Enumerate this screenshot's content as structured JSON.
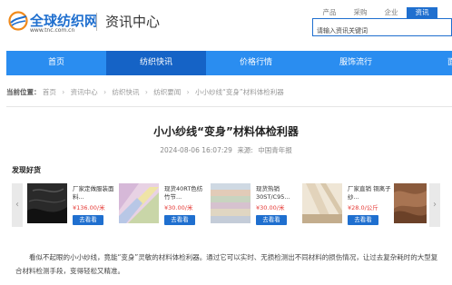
{
  "header": {
    "logo_name": "全球纺织网",
    "logo_url": "www.tnc.com.cn",
    "section_title": "资讯中心"
  },
  "search": {
    "tabs": [
      {
        "label": "产品",
        "active": false
      },
      {
        "label": "采购",
        "active": false
      },
      {
        "label": "企业",
        "active": false
      },
      {
        "label": "资讯",
        "active": true
      }
    ],
    "placeholder": "请输入资讯关键词"
  },
  "nav": {
    "items": [
      {
        "label": "首页",
        "active": false
      },
      {
        "label": "纺织快讯",
        "active": true
      },
      {
        "label": "价格行情",
        "active": false
      },
      {
        "label": "服饰流行",
        "active": false
      },
      {
        "label": "面料",
        "active": false
      }
    ]
  },
  "breadcrumb": {
    "lead": "当前位置：",
    "items": [
      "首页",
      "资讯中心",
      "纺织快讯",
      "纺织要闻",
      "小小纱线“变身”材料体检利器"
    ],
    "separator": "›"
  },
  "article": {
    "title": "小小纱线“变身”材料体检利器",
    "date": "2024-08-06 16:07:29",
    "source_label": "来源:",
    "source": "中国青年报",
    "body": "看似不起眼的小小纱线，竟能“变身”灵敏的材料体检利器。通过它可以实时、无损检测出不同材料的损伤情况，让过去复杂耗时的大型复合材料检测手段，变得轻松又精准。"
  },
  "goods": {
    "heading": "发现好货",
    "prev_icon": "chevron-left-icon",
    "next_icon": "chevron-right-icon",
    "items": [
      {
        "name": "厂家定做服装面料...",
        "price": "¥136.00",
        "unit": "/米",
        "button": "去看看"
      },
      {
        "name": "现货40RT色纺竹节...",
        "price": "¥30.00",
        "unit": "/米",
        "button": "去看看"
      },
      {
        "name": "现货热销30ST/C95...",
        "price": "¥30.00",
        "unit": "/米",
        "button": "去看看"
      },
      {
        "name": "厂家直销 铜离子纱...",
        "price": "¥28.0",
        "unit": "/公斤",
        "button": "去看看"
      }
    ]
  },
  "colors": {
    "brand_blue": "#1f6fcf",
    "nav_blue": "#2a8df0",
    "nav_active": "#1563c6",
    "price_red": "#e53935"
  }
}
